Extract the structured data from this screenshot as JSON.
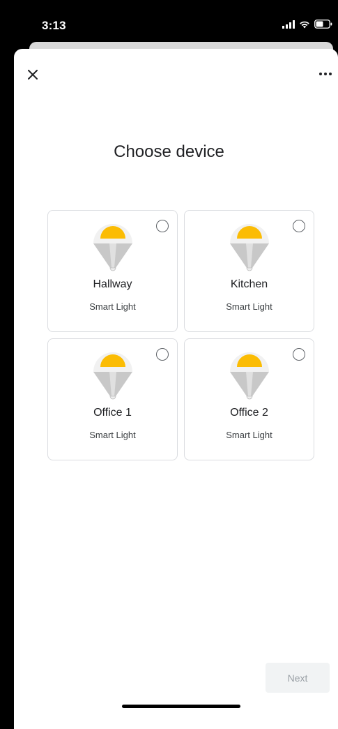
{
  "status_bar": {
    "time": "3:13",
    "icons": [
      "cellular-signal-icon",
      "wifi-icon",
      "battery-icon"
    ]
  },
  "header": {
    "close_icon": "close-icon",
    "more_icon": "more-options-icon"
  },
  "main": {
    "title": "Choose device",
    "devices": [
      {
        "name": "Hallway",
        "type": "Smart Light",
        "icon": "light-bulb-icon",
        "selected": false
      },
      {
        "name": "Kitchen",
        "type": "Smart Light",
        "icon": "light-bulb-icon",
        "selected": false
      },
      {
        "name": "Office 1",
        "type": "Smart Light",
        "icon": "light-bulb-icon",
        "selected": false
      },
      {
        "name": "Office 2",
        "type": "Smart Light",
        "icon": "light-bulb-icon",
        "selected": false
      }
    ]
  },
  "footer": {
    "next_label": "Next",
    "next_enabled": false
  },
  "colors": {
    "bulb_top": "#fbbc04",
    "bulb_body": "#c8c8c8",
    "card_border": "#dadce0",
    "next_bg": "#f1f3f4",
    "next_text": "#9aa0a6"
  }
}
